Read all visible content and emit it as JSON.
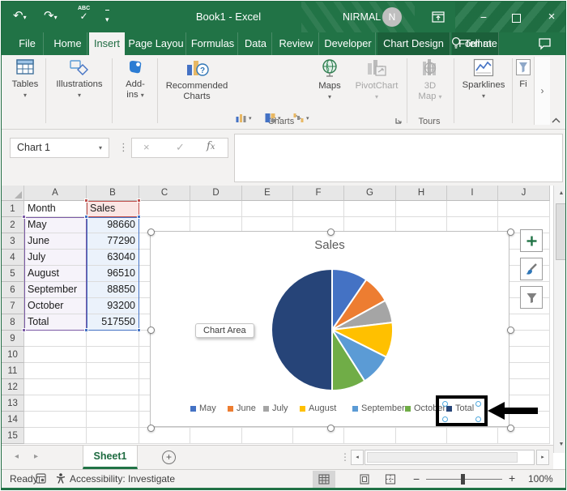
{
  "colors": {
    "excel_green": "#217346",
    "selection_purple": "#7B5AA5",
    "selection_blue": "#4472C4",
    "selection_red": "#C0504D",
    "fill_purple": "#F6F3FA",
    "fill_blue": "#EBF2FB",
    "fill_red": "#FAE6E4"
  },
  "titlebar": {
    "title": "Book1  -  Excel",
    "user": "NIRMAL",
    "avatar_initial": "N",
    "qat_icons": [
      "undo-icon",
      "redo-icon",
      "spelling-check-icon",
      "customize-qat-icon"
    ]
  },
  "tabs": [
    {
      "label": "File",
      "type": "file"
    },
    {
      "label": "Home",
      "type": "normal"
    },
    {
      "label": "Insert",
      "type": "active"
    },
    {
      "label": "Page Layou",
      "type": "normal"
    },
    {
      "label": "Formulas",
      "type": "normal"
    },
    {
      "label": "Data",
      "type": "normal"
    },
    {
      "label": "Review",
      "type": "normal"
    },
    {
      "label": "Developer",
      "type": "normal"
    },
    {
      "label": "Chart Design",
      "type": "contextual"
    },
    {
      "label": "Format",
      "type": "contextual"
    }
  ],
  "tell_me": "Tell me",
  "ribbon": {
    "tables": "Tables",
    "illustrations": "Illustrations",
    "addins_line1": "Add-",
    "addins_line2": "ins",
    "recommended_line1": "Recommended",
    "recommended_line2": "Charts",
    "mini_icons": [
      "column-chart-icon",
      "treemap-icon",
      "waterfall-icon",
      "line-chart-icon",
      "histogram-icon",
      "combo-chart-icon",
      "pie-chart-icon",
      "scatter-chart-icon"
    ],
    "maps": "Maps",
    "pivotchart": "PivotChart",
    "map3d_line1": "3D",
    "map3d_line2": "Map",
    "sparklines": "Sparklines",
    "filters_partial": "Fi",
    "group_charts": "Charts",
    "group_tours": "Tours"
  },
  "formula_bar": {
    "name_box": "Chart 1"
  },
  "grid": {
    "columns": [
      "A",
      "B",
      "C",
      "D",
      "E",
      "F",
      "G",
      "H",
      "I",
      "J"
    ],
    "rows": [
      {
        "n": "1",
        "A": "Month",
        "B": "Sales"
      },
      {
        "n": "2",
        "A": "May",
        "B": "98660"
      },
      {
        "n": "3",
        "A": "June",
        "B": "77290"
      },
      {
        "n": "4",
        "A": "July",
        "B": "63040"
      },
      {
        "n": "5",
        "A": "August",
        "B": "96510"
      },
      {
        "n": "6",
        "A": "September",
        "B": "88850"
      },
      {
        "n": "7",
        "A": "October",
        "B": "93200"
      },
      {
        "n": "8",
        "A": "Total",
        "B": "517550"
      },
      {
        "n": "9"
      },
      {
        "n": "10"
      },
      {
        "n": "11"
      },
      {
        "n": "12"
      },
      {
        "n": "13"
      },
      {
        "n": "14"
      },
      {
        "n": "15"
      }
    ]
  },
  "chart_data": {
    "type": "pie",
    "title": "Sales",
    "labels": [
      "May",
      "June",
      "July",
      "August",
      "September",
      "October",
      "Total"
    ],
    "values": [
      98660,
      77290,
      63040,
      96510,
      88850,
      93200,
      517550
    ],
    "colors": [
      "#4472C4",
      "#ED7D31",
      "#A5A5A5",
      "#FFC000",
      "#5B9BD5",
      "#70AD47",
      "#264478"
    ],
    "legend_position": "bottom",
    "selected_legend_item": "Total",
    "tooltip": "Chart Area",
    "side_buttons": [
      "chart-elements-plus-icon",
      "chart-styles-brush-icon",
      "chart-filters-funnel-icon"
    ]
  },
  "sheet_tabs": {
    "active": "Sheet1"
  },
  "status_bar": {
    "ready": "Ready",
    "accessibility": "Accessibility: Investigate",
    "zoom_level": "100%"
  }
}
